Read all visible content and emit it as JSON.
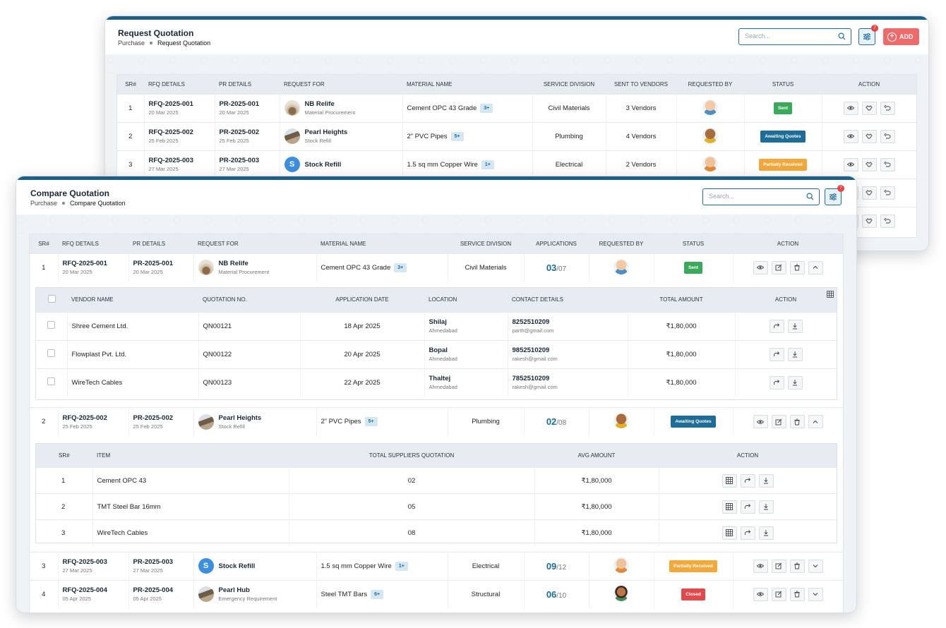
{
  "back": {
    "title": "Request Quotation",
    "breadcrumb": [
      "Purchase",
      "Request Quotation"
    ],
    "search_placeholder": "Search...",
    "filter_badge": "7",
    "add_label": "ADD",
    "columns": [
      "SR#",
      "RFQ DETAILS",
      "PR DETAILS",
      "REQUEST FOR",
      "MATERIAL NAME",
      "SERVICE DIVISION",
      "SENT TO VENDORS",
      "REQUESTED BY",
      "STATUS",
      "ACTION"
    ],
    "rows": [
      {
        "sr": "1",
        "rfq": "RFQ-2025-001",
        "rfq_date": "20 Mar 2025",
        "pr": "PR-2025-001",
        "pr_date": "20 Mar 2025",
        "req_name": "NB Relife",
        "req_sub": "Material Procurement",
        "material": "Cement OPC 43 Grade",
        "pill": "3+",
        "division": "Civil Materials",
        "vendors": "3 Vendors",
        "status": "Sent"
      },
      {
        "sr": "2",
        "rfq": "RFQ-2025-002",
        "rfq_date": "25 Feb 2025",
        "pr": "PR-2025-002",
        "pr_date": "25 Feb 2025",
        "req_name": "Pearl Heights",
        "req_sub": "Stock Refill",
        "material": "2” PVC Pipes",
        "pill": "5+",
        "division": "Plumbing",
        "vendors": "4 Vendors",
        "status": "Awaiting Quotes"
      },
      {
        "sr": "3",
        "rfq": "RFQ-2025-003",
        "rfq_date": "27 Mar 2025",
        "pr": "PR-2025-003",
        "pr_date": "27 Mar 2025",
        "req_name": "Stock Refill",
        "req_sub": "",
        "material": "1.5 sq mm Copper Wire",
        "pill": "1+",
        "division": "Electrical",
        "vendors": "2 Vendors",
        "status": "Partially Received"
      }
    ]
  },
  "front": {
    "title": "Compare Quotation",
    "breadcrumb": [
      "Purchase",
      "Compare Quotation"
    ],
    "search_placeholder": "Search...",
    "filter_badge": "7",
    "columns": [
      "SR#",
      "RFQ DETAILS",
      "PR DETAILS",
      "REQUEST FOR",
      "MATERIAL NAME",
      "SERVICE DIVISION",
      "APPLICATIONS",
      "REQUESTED BY",
      "STATUS",
      "ACTION"
    ],
    "rows": [
      {
        "sr": "1",
        "rfq": "RFQ-2025-001",
        "rfq_date": "20 Mar 2025",
        "pr": "PR-2025-001",
        "pr_date": "20 Mar 2025",
        "req_name": "NB Relife",
        "req_sub": "Material Procurement",
        "material": "Cement OPC 43 Grade",
        "pill": "3+",
        "division": "Civil Materials",
        "apps": "03",
        "apps_total": "/07",
        "status": "Sent"
      },
      {
        "sr": "2",
        "rfq": "RFQ-2025-002",
        "rfq_date": "25 Feb 2025",
        "pr": "PR-2025-002",
        "pr_date": "25 Feb 2025",
        "req_name": "Pearl Heights",
        "req_sub": "Stock Refill",
        "material": "2” PVC Pipes",
        "pill": "5+",
        "division": "Plumbing",
        "apps": "02",
        "apps_total": "/08",
        "status": "Awaiting Quotes"
      },
      {
        "sr": "3",
        "rfq": "RFQ-2025-003",
        "rfq_date": "27 Mar 2025",
        "pr": "PR-2025-003",
        "pr_date": "27 Mar 2025",
        "req_name": "Stock Refill",
        "req_sub": "",
        "material": "1.5 sq mm Copper Wire",
        "pill": "1+",
        "division": "Electrical",
        "apps": "09",
        "apps_total": "/12",
        "status": "Partially Received"
      },
      {
        "sr": "4",
        "rfq": "RFQ-2025-004",
        "rfq_date": "05 Apr 2025",
        "pr": "PR-2025-004",
        "pr_date": "05 Apr 2025",
        "req_name": "Pearl Hub",
        "req_sub": "Emergency Requirement",
        "material": "Steel TMT Bars",
        "pill": "6+",
        "division": "Structural",
        "apps": "06",
        "apps_total": "/10",
        "status": "Closed"
      }
    ],
    "vendor_table": {
      "columns": [
        "VENDOR NAME",
        "QUOTATION NO.",
        "APPLICATION DATE",
        "LOCATION",
        "CONTACT DETAILS",
        "TOTAL AMOUNT",
        "ACTION"
      ],
      "rows": [
        {
          "vendor": "Shree Cement Ltd.",
          "quote": "QN00121",
          "date": "18 Apr 2025",
          "loc": "Shilaj",
          "city": "Ahmedabad",
          "phone": "8252510209",
          "email": "parth@gmail.com",
          "amount": "₹1,80,000"
        },
        {
          "vendor": "Flowplast Pvt. Ltd.",
          "quote": "QN00122",
          "date": "20 Apr 2025",
          "loc": "Bopal",
          "city": "Ahmedabad",
          "phone": "9852510209",
          "email": "rakesh@gmail.com",
          "amount": "₹1,80,000"
        },
        {
          "vendor": "WireTech Cables",
          "quote": "QN00123",
          "date": "22 Apr 2025",
          "loc": "Thaltej",
          "city": "Ahmedabad",
          "phone": "7852510209",
          "email": "rakesh@gmail.com",
          "amount": "₹1,80,000"
        }
      ]
    },
    "item_table": {
      "columns": [
        "SR#",
        "ITEM",
        "TOTAL SUPPLIERS QUOTATION",
        "AVG AMOUNT",
        "ACTION"
      ],
      "rows": [
        {
          "sr": "1",
          "item": "Cement OPC 43",
          "total": "02",
          "avg": "₹1,80,000"
        },
        {
          "sr": "2",
          "item": "TMT Steel Bar 16mm",
          "total": "05",
          "avg": "₹1,80,000"
        },
        {
          "sr": "3",
          "item": "WireTech Cables",
          "total": "08",
          "avg": "₹1,80,000"
        }
      ]
    }
  }
}
